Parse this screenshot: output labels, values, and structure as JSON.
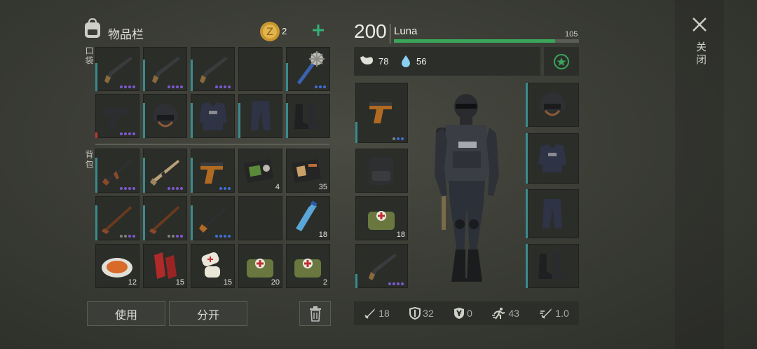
{
  "inventory": {
    "title": "物品栏",
    "coins": "2",
    "pockets_label": "口袋",
    "backpack_label": "背包",
    "use_label": "使用",
    "split_label": "分开"
  },
  "player": {
    "level": "200",
    "name": "Luna",
    "xp_value": "105",
    "hunger": "78",
    "thirst": "56"
  },
  "close_label": "关闭",
  "equip_counts": {
    "medkit": "18"
  },
  "stats": {
    "attack": "18",
    "defense": "32",
    "radiation": "0",
    "speed": "43",
    "weight": "1.0"
  },
  "counts": {
    "wallet_small": "4",
    "wallet_large": "35",
    "water": "18",
    "food": "12",
    "meat": "15",
    "bandage": "15",
    "medkit_a": "20",
    "medkit_b": "2"
  },
  "colors": {
    "accent": "#3aa65a",
    "durability": "#3a8a8e",
    "rarity_purple": "#7a5bd0",
    "rarity_blue": "#3f6fd8"
  }
}
